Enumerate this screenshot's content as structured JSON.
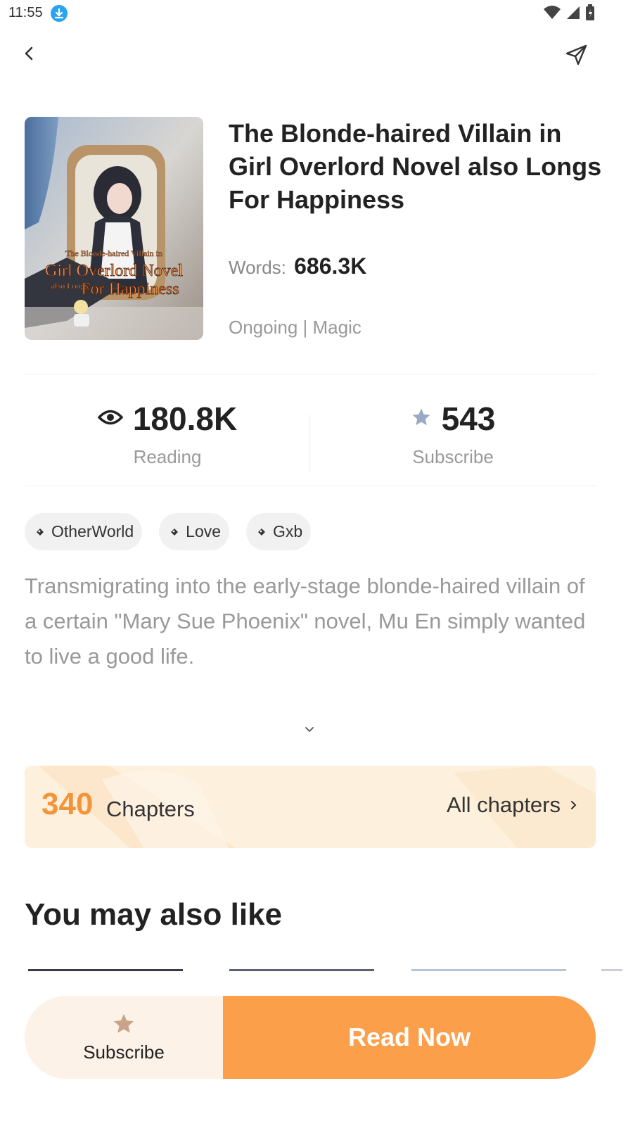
{
  "status_bar": {
    "time": "11:55"
  },
  "book": {
    "title": "The Blonde-haired Villain in Girl Overlord Novel also Longs For Happiness",
    "words_label": "Words:",
    "words_value": "686.3K",
    "meta": "Ongoing | Magic",
    "cover_text": {
      "line1": "The Blonde-haired Villain in",
      "line2": "Girl Overlord Novel",
      "line3": "also Longs",
      "line4": "For Happiness"
    }
  },
  "stats": {
    "reading_value": "180.8K",
    "reading_label": "Reading",
    "subscribe_value": "543",
    "subscribe_label": "Subscribe"
  },
  "tags": [
    "OtherWorld",
    "Love",
    "Gxb"
  ],
  "description": "Transmigrating into the early-stage blonde-haired villain of a certain \"Mary Sue Phoenix\" novel, Mu En simply wanted to live a good life.",
  "chapters": {
    "count": "340",
    "label": "Chapters",
    "all_label": "All chapters"
  },
  "recommend": {
    "title": "You may also like"
  },
  "bottom_bar": {
    "subscribe_label": "Subscribe",
    "read_label": "Read Now"
  },
  "colors": {
    "accent": "#fb9f4a",
    "chapters_count": "#f4943a",
    "chapters_bg": "#fdf0dd",
    "subscribe_bg": "#fdf2e8"
  }
}
